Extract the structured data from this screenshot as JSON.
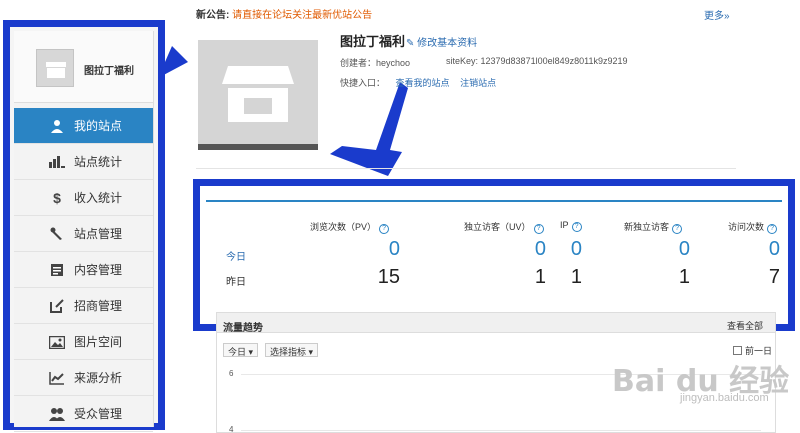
{
  "notice": {
    "title": "新公告:",
    "message": "请直接在论坛关注最新优站公告",
    "more": "更多»"
  },
  "site": {
    "name": "图拉丁福利"
  },
  "nav": [
    {
      "label": "我的站点",
      "icon": "user-icon",
      "active": true
    },
    {
      "label": "站点统计",
      "icon": "bar-chart-icon"
    },
    {
      "label": "收入统计",
      "icon": "dollar-icon"
    },
    {
      "label": "站点管理",
      "icon": "wrench-icon"
    },
    {
      "label": "内容管理",
      "icon": "document-icon"
    },
    {
      "label": "招商管理",
      "icon": "edit-icon"
    },
    {
      "label": "图片空间",
      "icon": "image-icon"
    },
    {
      "label": "来源分析",
      "icon": "line-chart-icon"
    },
    {
      "label": "受众管理",
      "icon": "users-icon"
    }
  ],
  "profile": {
    "name": "图拉丁福利",
    "edit_link": "修改基本资料",
    "creator": "创建者：heychoo",
    "sitekey": "siteKey: 12379d83871l00el849z8011k9z9219",
    "quick_label": "快捷入口：",
    "quick_links": [
      "查看我的站点",
      "注销站点"
    ]
  },
  "stats": {
    "columns": [
      "浏览次数（PV）",
      "独立访客（UV）",
      "IP",
      "新独立访客",
      "访问次数"
    ],
    "help": "?",
    "rows": [
      {
        "label": "今日",
        "values": [
          "0",
          "0",
          "0",
          "0",
          "0"
        ]
      },
      {
        "label": "昨日",
        "values": [
          "15",
          "1",
          "1",
          "1",
          "7"
        ]
      }
    ]
  },
  "trend": {
    "title": "流量趋势",
    "view_all": "查看全部",
    "selectors": [
      "今日 ▾",
      "选择指标 ▾"
    ],
    "prev_day": "前一日",
    "y_ticks": [
      "6",
      "4"
    ]
  },
  "watermark": {
    "main": "Bai du 经验",
    "sub": "jingyan.baidu.com"
  },
  "colors": {
    "accent": "#2a84c4",
    "annotation": "#1a3bcc",
    "notice": "#e05a00"
  }
}
